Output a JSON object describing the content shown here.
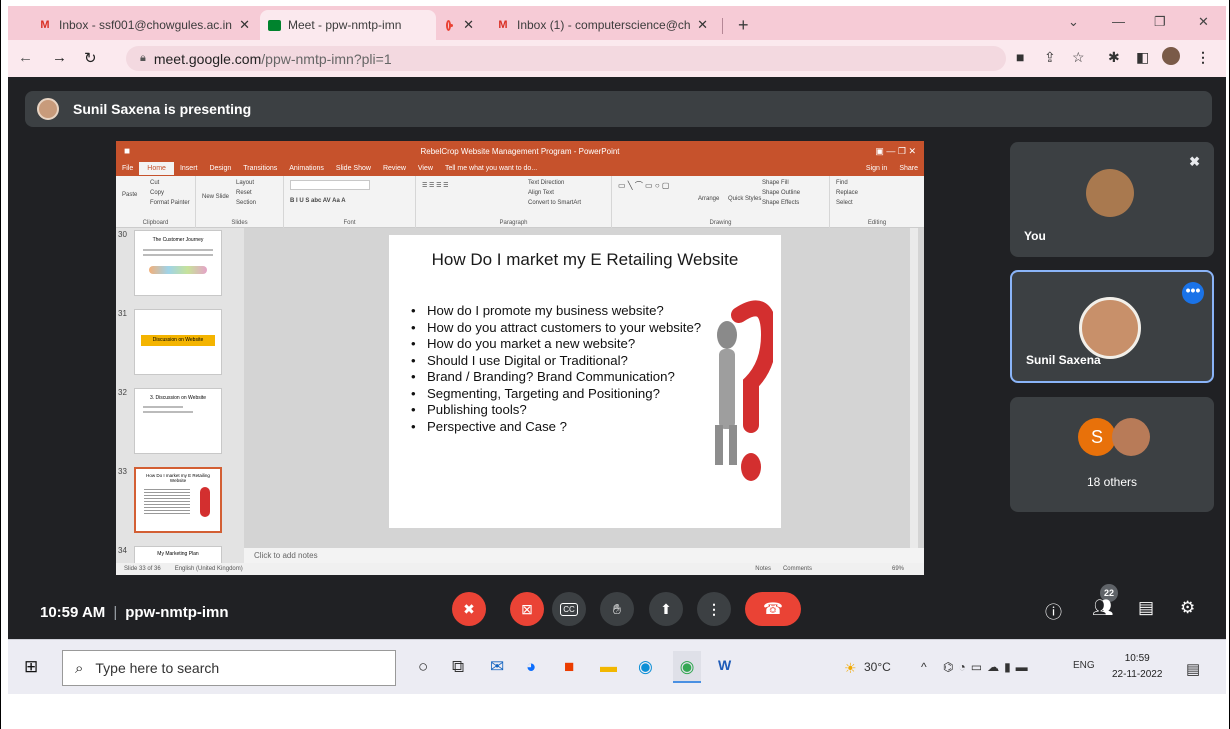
{
  "browser": {
    "tabs": [
      {
        "title": "Inbox - ssf001@chowgules.ac.in",
        "icon": "gmail-icon",
        "active": false
      },
      {
        "title": "Meet - ppw-nmtp-imn",
        "icon": "meet-icon",
        "active": true
      },
      {
        "title": "Inbox (1) - computerscience@ch",
        "icon": "gmail-icon",
        "active": false
      }
    ],
    "url_host": "meet.google.com",
    "url_path": "/ppw-nmtp-imn?pli=1",
    "new_tab": "+",
    "recording_dot_color": "#ea4335"
  },
  "meet": {
    "presenting_text": "Sunil Saxena is presenting",
    "time": "10:59 AM",
    "meeting_code": "ppw-nmtp-imn",
    "participant_count": "22",
    "tiles": {
      "you_label": "You",
      "sunil_label": "Sunil Saxena",
      "others_label": "18 others",
      "others_initial": "S"
    },
    "colors": {
      "background": "#202124",
      "tile": "#3c4043",
      "end_call": "#ea4335",
      "active_border": "#8ab4f8",
      "more_button": "#1a73e8"
    }
  },
  "powerpoint": {
    "window_title": "RebelCrop Website Management Program - PowerPoint",
    "tabs": [
      "File",
      "Home",
      "Insert",
      "Design",
      "Transitions",
      "Animations",
      "Slide Show",
      "Review",
      "View",
      "Tell me what you want to do..."
    ],
    "sign_in": "Sign in",
    "share": "Share",
    "ribbon": {
      "clipboard": [
        "Cut",
        "Copy",
        "Paste",
        "Format Painter"
      ],
      "clipboard_label": "Clipboard",
      "slides": [
        "Layout",
        "Reset",
        "New Slide",
        "Section"
      ],
      "slides_label": "Slides",
      "font_label": "Font",
      "paragraph": [
        "Text Direction",
        "Align Text",
        "Convert to SmartArt"
      ],
      "paragraph_label": "Paragraph",
      "drawing": [
        "Shape Fill",
        "Shape Outline",
        "Shape Effects",
        "Arrange",
        "Quick Styles"
      ],
      "drawing_label": "Drawing",
      "editing": [
        "Find",
        "Replace",
        "Select"
      ],
      "editing_label": "Editing"
    },
    "thumbnails": [
      {
        "num": "30",
        "title": "The Customer Journey"
      },
      {
        "num": "31",
        "title": "Discussion on Website"
      },
      {
        "num": "32",
        "title": "3. Discussion on Website"
      },
      {
        "num": "33",
        "title": "How Do I market my E Retailing Website"
      },
      {
        "num": "34",
        "title": "My Marketing Plan"
      }
    ],
    "slide": {
      "title": "How Do I market my E Retailing Website",
      "bullets": [
        "How do I promote my business website?",
        "How do you attract customers to your website?",
        "How do you market a new website?",
        "Should I use Digital or Traditional?",
        "Brand / Branding? Brand Communication?",
        "Segmenting, Targeting and Positioning?",
        "Publishing tools?",
        "Perspective and Case ?"
      ]
    },
    "notes_placeholder": "Click to add notes",
    "status_slide": "Slide 33 of 36",
    "status_lang": "English (United Kingdom)",
    "status_notes": "Notes",
    "status_comments": "Comments",
    "zoom": "69%"
  },
  "taskbar": {
    "search_placeholder": "Type here to search",
    "weather": "30°C",
    "lang": "ENG",
    "time": "10:59",
    "date": "22-11-2022"
  }
}
